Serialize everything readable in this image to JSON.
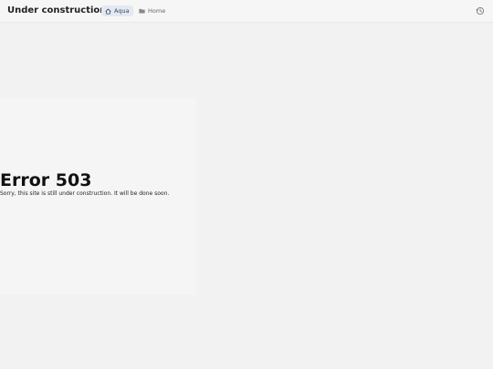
{
  "header": {
    "title": "Under construction",
    "tabs": [
      {
        "label": "Aqua",
        "icon": "home-icon",
        "active": true
      },
      {
        "label": "Home",
        "icon": "folder-icon",
        "active": false
      }
    ],
    "history_icon": "history-icon"
  },
  "main": {
    "error_title": "Error 503",
    "error_message": "Sorry, this site is still under construction. It will be done soon."
  },
  "colors": {
    "background": "#f2f2f2",
    "active_tab_bg": "#e4e8f0",
    "active_tab_text": "#3a4a66"
  }
}
